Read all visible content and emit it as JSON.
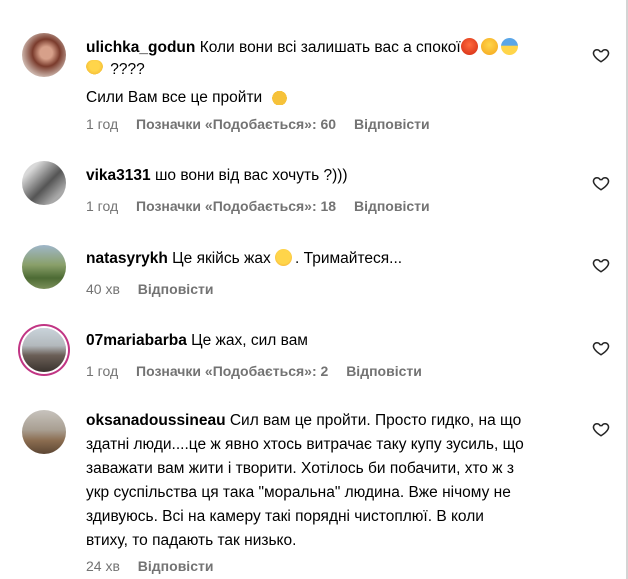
{
  "comments": [
    {
      "username": "ulichka_godun",
      "text_line1": "Коли вони всі залишать вас а спокої",
      "text_line2_tail": " ????",
      "text_line3": "Сили Вам все це пройти",
      "time": "1 год",
      "likes": "Позначки «Подобається»: 60",
      "reply": "Відповісти"
    },
    {
      "username": "vika3131",
      "text": "шо вони від вас хочуть ?)))",
      "time": "1 год",
      "likes": "Позначки «Подобається»: 18",
      "reply": "Відповісти"
    },
    {
      "username": "natasyrykh",
      "text_before": "Це якійсь жах",
      "text_after": ". Тримайтеся...",
      "time": "40 хв",
      "reply": "Відповісти"
    },
    {
      "username": "07mariabarba",
      "text": "Це жах, сил вам",
      "time": "1 год",
      "likes": "Позначки «Подобається»: 2",
      "reply": "Відповісти"
    },
    {
      "username": "oksanadoussineau",
      "text_line1": "Сил вам це пройти. Просто гидко, на що",
      "text_line2": "здатні люди....це ж явно хтось витрачає таку купу зусиль, що",
      "text_line3": "заважати вам жити і творити. Хотілось би побачити, хто ж з",
      "text_line4": "укр суспільства ця така \"моральна\" людина. Вже нічому не",
      "text_line5": "здивуюсь. Всі на камеру такі порядні чистоплюї. В коли",
      "text_line6": "втиху, то падають так низько.",
      "time": "24 хв",
      "reply": "Відповісти"
    }
  ],
  "icons": {
    "like": "heart-outline-icon",
    "emoji": [
      "angry-face",
      "weary-face",
      "screaming-face",
      "woman-gesturing",
      "folded-hands",
      "flushed-face"
    ]
  },
  "colors": {
    "secondary_text": "#737373",
    "story_ring": "#c13584"
  }
}
